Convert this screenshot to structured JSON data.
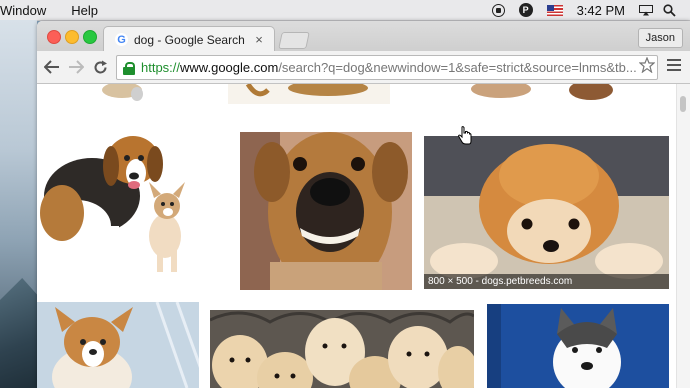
{
  "menubar": {
    "items": [
      "Window",
      "Help"
    ],
    "p_badge": "P",
    "clock": "3:42 PM",
    "icons": [
      "record-icon",
      "p-badge-icon",
      "us-flag-icon",
      "airplay-icon",
      "spotlight-search-icon"
    ]
  },
  "browser": {
    "tab_title": "dog - Google Search",
    "tab_close": "×",
    "favicon": "G",
    "profile": "Jason",
    "url": {
      "scheme": "https://",
      "host": "www.google.com",
      "rest": "/search?q=dog&newwindow=1&safe=strict&source=lnms&tb..."
    }
  },
  "results": {
    "hover_caption": "800 × 500 - dogs.petbreeds.com",
    "images": [
      "beagle-chihuahua",
      "smiling-dog",
      "fluffy-pomeranian",
      "corgi-puppy",
      "golden-puppies",
      "husky-puppy"
    ]
  },
  "colors": {
    "secure_green": "#1f8f2e",
    "close_red": "#fc5f57",
    "min_yellow": "#fdbc2e",
    "max_green": "#28c840"
  }
}
